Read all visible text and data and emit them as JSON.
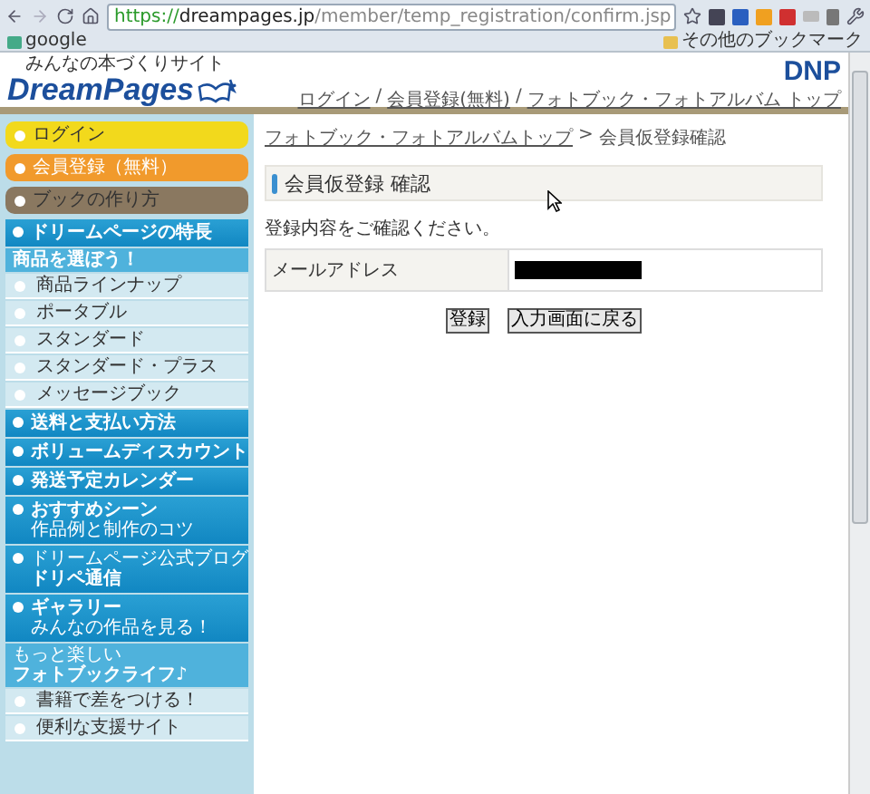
{
  "browser": {
    "url_scheme": "https://",
    "url_host": "dreampages.jp",
    "url_path": "/member/temp_registration/confirm.jsp",
    "bookmarks": [
      {
        "label": "google",
        "kind": "site"
      },
      {
        "label": "その他のブックマーク",
        "kind": "folder"
      }
    ]
  },
  "header": {
    "tagline": "みんなの本づくりサイト",
    "logo": "DreamPages",
    "brand": "DNP",
    "link_separator": "/",
    "links": [
      "ログイン",
      "会員登録(無料)",
      "フォトブック・フォトアルバム トップ"
    ]
  },
  "sidebar": {
    "items": [
      {
        "kind": "pill",
        "label": "ログイン",
        "color": "#f2d91c"
      },
      {
        "kind": "pill",
        "label": "会員登録（無料）",
        "color": "#f19a2c"
      },
      {
        "kind": "pill",
        "label": "ブックの作り方",
        "color": "#8a7860"
      },
      {
        "kind": "section",
        "label": "ドリームページの特長"
      },
      {
        "kind": "heading",
        "label": "商品を選ぼう！"
      },
      {
        "kind": "sub",
        "label": "商品ラインナップ"
      },
      {
        "kind": "sub",
        "label": "ポータブル"
      },
      {
        "kind": "sub",
        "label": "スタンダード"
      },
      {
        "kind": "sub",
        "label": "スタンダード・プラス"
      },
      {
        "kind": "sub",
        "label": "メッセージブック"
      },
      {
        "kind": "section",
        "label": "送料と支払い方法"
      },
      {
        "kind": "section",
        "label": "ボリュームディスカウント"
      },
      {
        "kind": "section",
        "label": "発送予定カレンダー"
      },
      {
        "kind": "section",
        "label": "おすすめシーン",
        "caption": "作品例と制作のコツ"
      },
      {
        "kind": "section",
        "overline": "ドリームページ公式ブログ",
        "label": "ドリペ通信"
      },
      {
        "kind": "section",
        "label": "ギャラリー",
        "caption": "みんなの作品を見る！"
      },
      {
        "kind": "heading",
        "overline": "もっと楽しい",
        "label": "フォトブックライフ♪"
      },
      {
        "kind": "sub",
        "label": "書籍で差をつける！"
      },
      {
        "kind": "sub",
        "label": "便利な支援サイト"
      }
    ]
  },
  "main": {
    "breadcrumb": {
      "link": "フォトブック・フォトアルバムトップ",
      "separator": ">",
      "current": "会員仮登録確認"
    },
    "title": "会員仮登録 確認",
    "note": "登録内容をご確認ください。",
    "rows": [
      {
        "label": "メールアドレス"
      }
    ],
    "buttons": [
      "登録",
      "入力画面に戻る"
    ]
  }
}
